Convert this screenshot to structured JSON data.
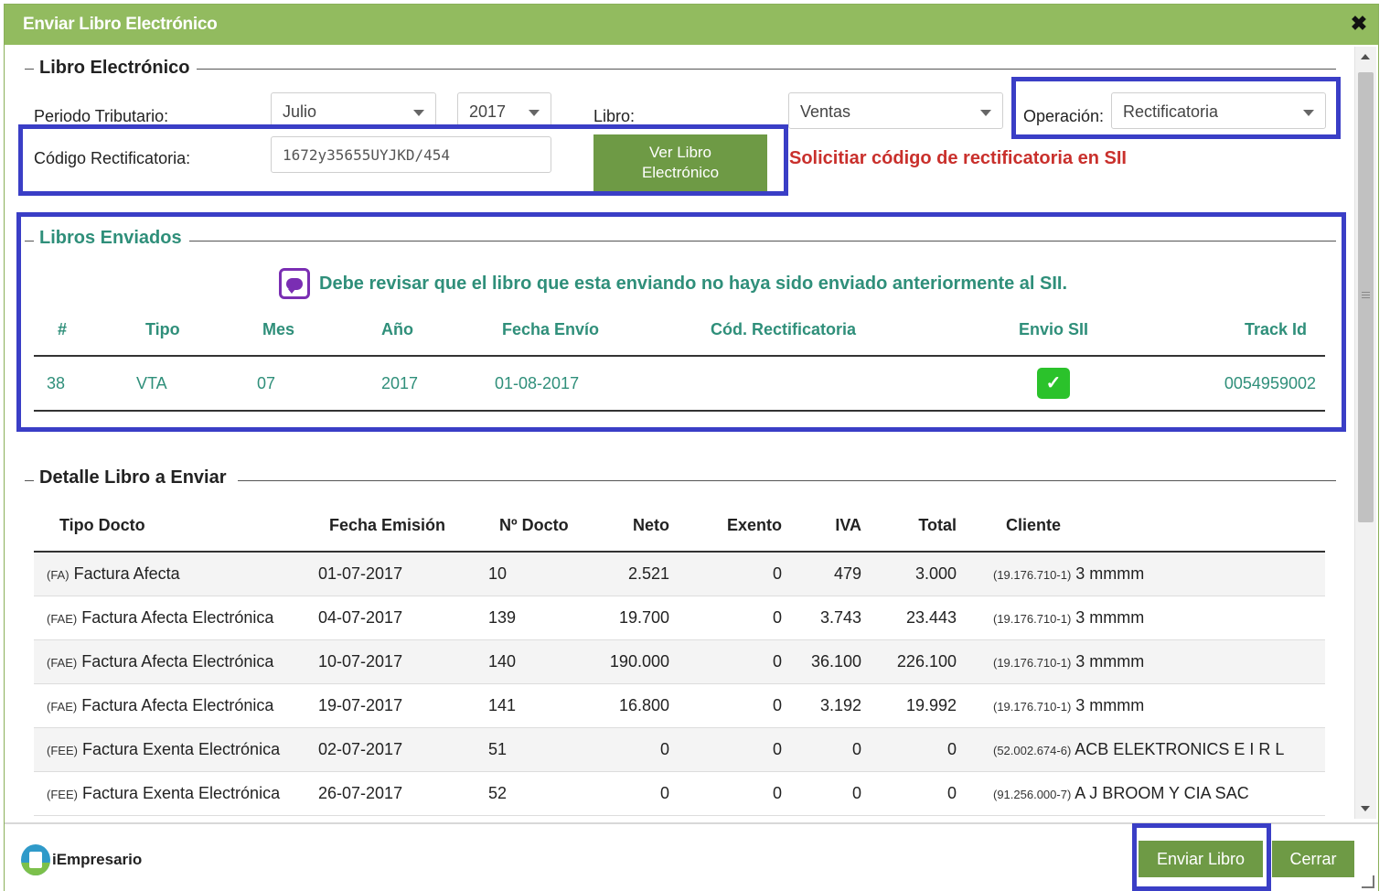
{
  "dialog": {
    "title": "Enviar Libro Electrónico",
    "close_icon": "✖"
  },
  "libro": {
    "legend": "Libro Electrónico",
    "periodo_label": "Periodo Tributario:",
    "month_value": "Julio",
    "year_value": "2017",
    "libro_label": "Libro:",
    "libro_value": "Ventas",
    "operacion_label": "Operación:",
    "operacion_value": "Rectificatoria",
    "codigo_label": "Código Rectificatoria:",
    "codigo_value": "1672y35655UYJKD/454",
    "ver_button_line1": "Ver Libro",
    "ver_button_line2": "Electrónico",
    "warning": "Solicitiar código de rectificatoria en SII"
  },
  "enviados": {
    "legend": "Libros Enviados",
    "notice": "Debe revisar que el libro que esta enviando no haya sido enviado anteriormente al SII.",
    "headers": [
      "#",
      "Tipo",
      "Mes",
      "Año",
      "Fecha Envío",
      "Cód. Rectificatoria",
      "Envio SII",
      "Track Id"
    ],
    "rows": [
      {
        "num": "38",
        "tipo": "VTA",
        "mes": "07",
        "anio": "2017",
        "fecha": "01-08-2017",
        "cod": "",
        "envio_icon": "check-icon",
        "track": "0054959002"
      }
    ]
  },
  "detalle": {
    "legend": "Detalle Libro a Enviar",
    "headers": [
      "Tipo Docto",
      "Fecha Emisión",
      "Nº Docto",
      "Neto",
      "Exento",
      "IVA",
      "Total",
      "Cliente"
    ],
    "rows": [
      {
        "pre": "(FA)",
        "tipo": "Factura Afecta",
        "fecha": "01-07-2017",
        "num": "10",
        "neto": "2.521",
        "exento": "0",
        "iva": "479",
        "total": "3.000",
        "rut": "(19.176.710-1)",
        "cliente": "3 mmmm"
      },
      {
        "pre": "(FAE)",
        "tipo": "Factura Afecta Electrónica",
        "fecha": "04-07-2017",
        "num": "139",
        "neto": "19.700",
        "exento": "0",
        "iva": "3.743",
        "total": "23.443",
        "rut": "(19.176.710-1)",
        "cliente": "3 mmmm"
      },
      {
        "pre": "(FAE)",
        "tipo": "Factura Afecta Electrónica",
        "fecha": "10-07-2017",
        "num": "140",
        "neto": "190.000",
        "exento": "0",
        "iva": "36.100",
        "total": "226.100",
        "rut": "(19.176.710-1)",
        "cliente": "3 mmmm"
      },
      {
        "pre": "(FAE)",
        "tipo": "Factura Afecta Electrónica",
        "fecha": "19-07-2017",
        "num": "141",
        "neto": "16.800",
        "exento": "0",
        "iva": "3.192",
        "total": "19.992",
        "rut": "(19.176.710-1)",
        "cliente": "3 mmmm"
      },
      {
        "pre": "(FEE)",
        "tipo": "Factura Exenta Electrónica",
        "fecha": "02-07-2017",
        "num": "51",
        "neto": "0",
        "exento": "0",
        "iva": "0",
        "total": "0",
        "rut": "(52.002.674-6)",
        "cliente": "ACB ELEKTRONICS E I R L"
      },
      {
        "pre": "(FEE)",
        "tipo": "Factura Exenta Electrónica",
        "fecha": "26-07-2017",
        "num": "52",
        "neto": "0",
        "exento": "0",
        "iva": "0",
        "total": "0",
        "rut": "(91.256.000-7)",
        "cliente": "A J BROOM Y CIA SAC"
      }
    ]
  },
  "footer": {
    "logo_text": "iEmpresario",
    "enviar_button": "Enviar Libro",
    "cerrar_button": "Cerrar"
  },
  "colors": {
    "titlebar": "#92bb5f",
    "button": "#6e9a45",
    "highlight": "#3a3ec6",
    "warning": "#c9302c",
    "teal": "#2f8f7a"
  }
}
